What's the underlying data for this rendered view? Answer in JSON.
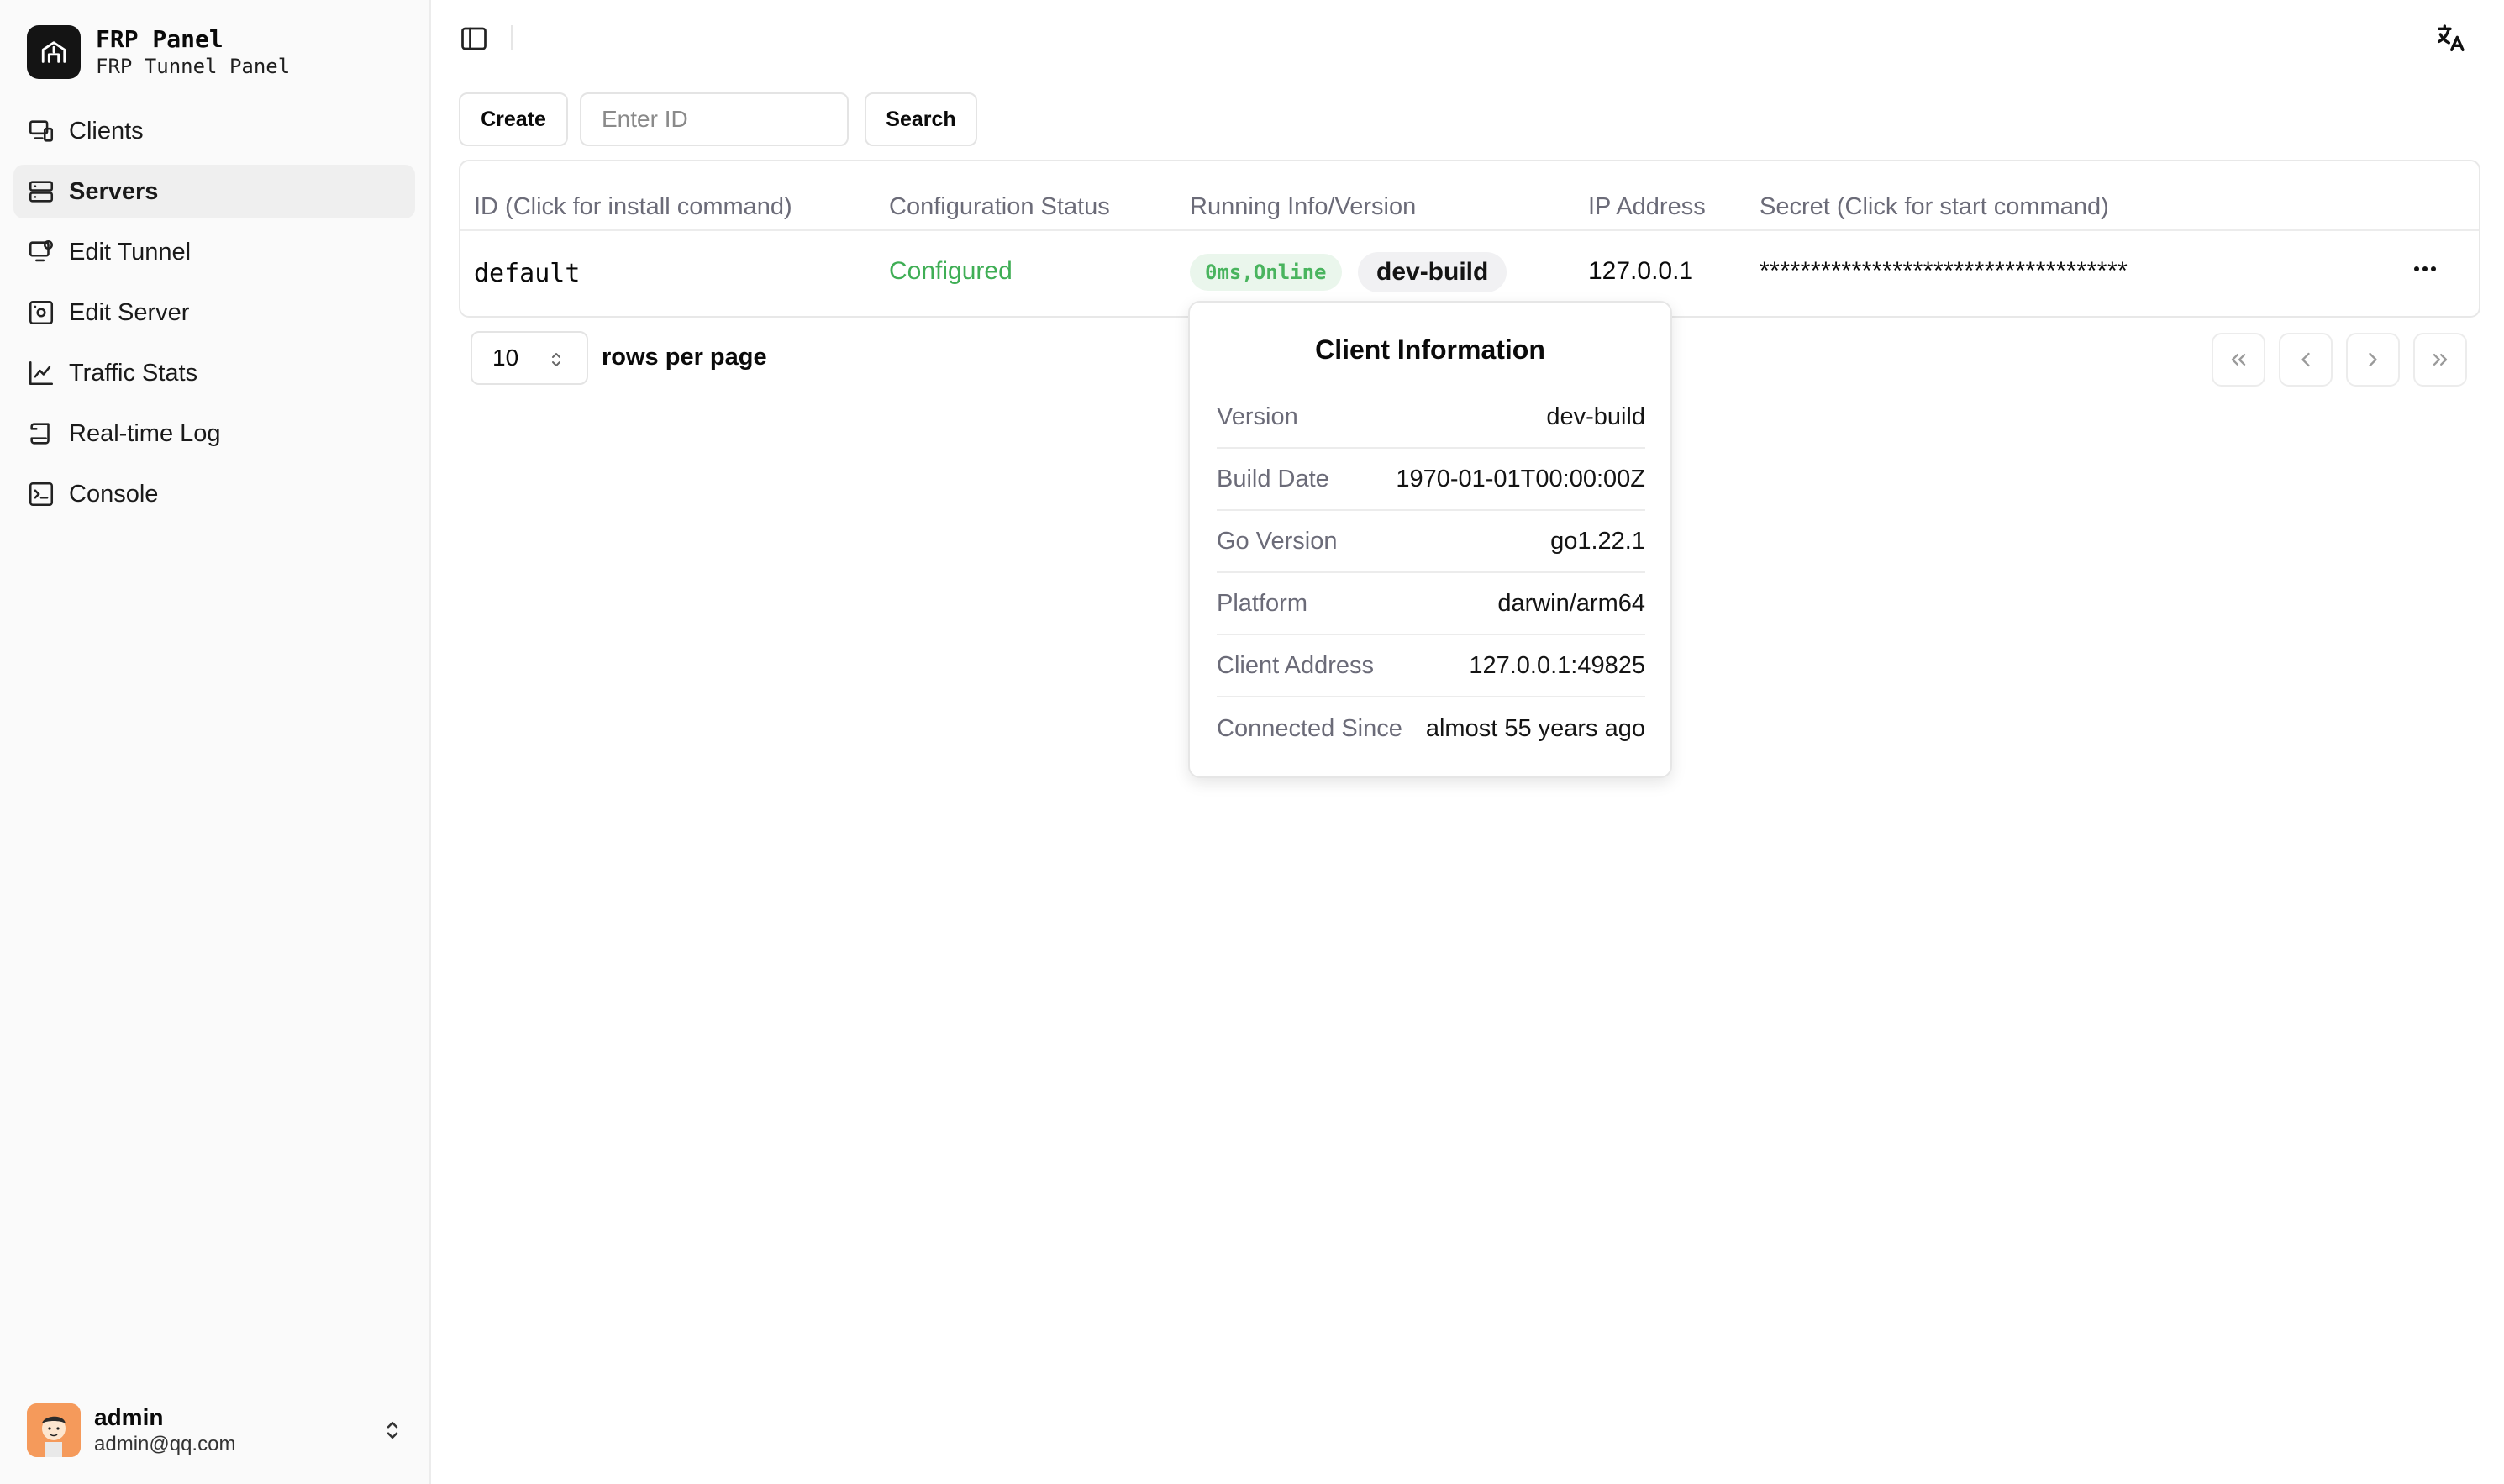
{
  "brand": {
    "title": "FRP Panel",
    "subtitle": "FRP Tunnel Panel"
  },
  "sidebar": {
    "items": [
      {
        "label": "Clients",
        "icon": "clients-icon"
      },
      {
        "label": "Servers",
        "icon": "servers-icon",
        "active": true
      },
      {
        "label": "Edit Tunnel",
        "icon": "edit-tunnel-icon"
      },
      {
        "label": "Edit Server",
        "icon": "edit-server-icon"
      },
      {
        "label": "Traffic Stats",
        "icon": "chart-icon"
      },
      {
        "label": "Real-time Log",
        "icon": "scroll-icon"
      },
      {
        "label": "Console",
        "icon": "terminal-icon"
      }
    ]
  },
  "user": {
    "name": "admin",
    "email": "admin@qq.com"
  },
  "toolbar": {
    "create_label": "Create",
    "search_placeholder": "Enter ID",
    "search_label": "Search"
  },
  "table": {
    "headers": [
      "ID (Click for install command)",
      "Configuration Status",
      "Running Info/Version",
      "IP Address",
      "Secret (Click for start command)"
    ],
    "rows": [
      {
        "id": "default",
        "status": "Configured",
        "online": "0ms,Online",
        "version": "dev-build",
        "ip": "127.0.0.1",
        "secret": "************************************"
      }
    ]
  },
  "pagination": {
    "rows_per_page": "10",
    "rows_label": "rows per page"
  },
  "popover": {
    "title": "Client Information",
    "fields": [
      {
        "label": "Version",
        "value": "dev-build"
      },
      {
        "label": "Build Date",
        "value": "1970-01-01T00:00:00Z"
      },
      {
        "label": "Go Version",
        "value": "go1.22.1"
      },
      {
        "label": "Platform",
        "value": "darwin/arm64"
      },
      {
        "label": "Client Address",
        "value": "127.0.0.1:49825"
      },
      {
        "label": "Connected Since",
        "value": "almost 55 years ago"
      }
    ]
  },
  "colors": {
    "accent_green": "#3fae55",
    "muted_text": "#6b6b78",
    "sidebar_bg": "#fafafa"
  }
}
